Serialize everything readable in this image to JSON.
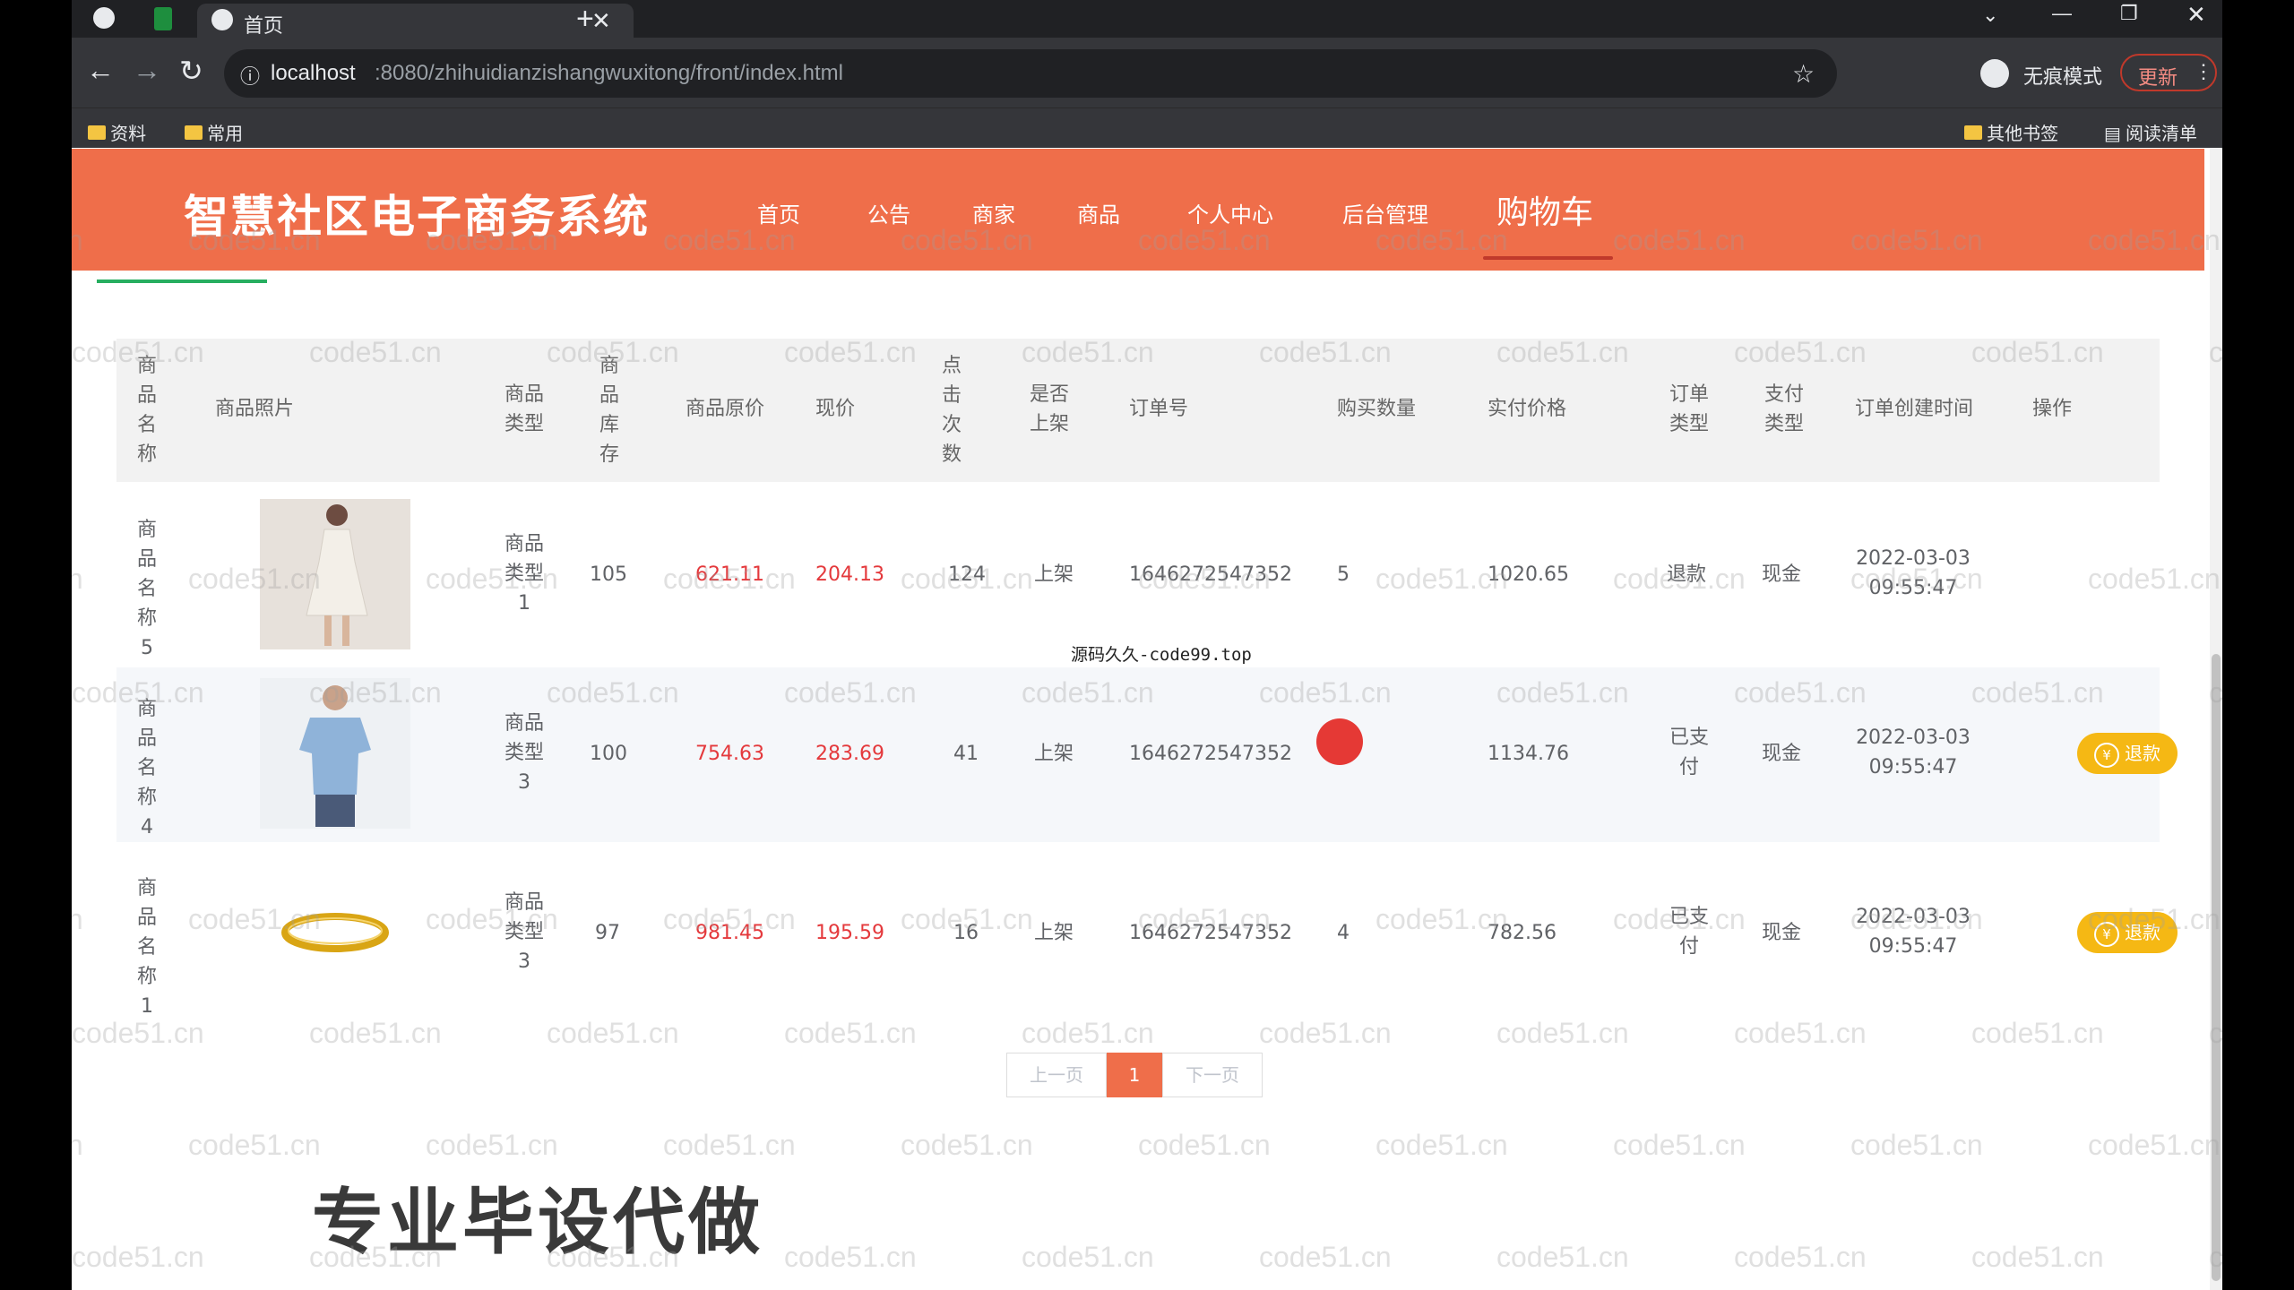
{
  "browser": {
    "tab_title": "首页",
    "url_host": "localhost",
    "url_path": ":8080/zhihuidianzishangwuxitong/front/index.html",
    "incognito_label": "无痕模式",
    "update_label": "更新",
    "bookmarks": [
      "资料",
      "常用"
    ],
    "other_bookmarks": "其他书签",
    "reading_list": "阅读清单"
  },
  "site": {
    "title": "智慧社区电子商务系统",
    "nav": [
      "首页",
      "公告",
      "商家",
      "商品",
      "个人中心",
      "后台管理",
      "购物车"
    ]
  },
  "table": {
    "headers": {
      "name": "商品名称",
      "photo": "商品照片",
      "type": "商品类型",
      "stock": "商品库存",
      "orig_price": "商品原价",
      "price": "现价",
      "clicks": "点击次数",
      "listed": "是否上架",
      "order_no": "订单号",
      "qty": "购买数量",
      "paid": "实付价格",
      "order_type": "订单类型",
      "pay_type": "支付类型",
      "created": "订单创建时间",
      "op": "操作"
    },
    "rows": [
      {
        "name": "商品名称5",
        "type": "商品类型1",
        "stock": "105",
        "orig_price": "621.11",
        "price": "204.13",
        "clicks": "124",
        "listed": "上架",
        "order_no": "1646272547352",
        "qty": "5",
        "paid": "1020.65",
        "order_type": "退款",
        "pay_type": "现金",
        "created": "2022-03-03 09:55:47",
        "action": ""
      },
      {
        "name": "商品名称4",
        "type": "商品类型3",
        "stock": "100",
        "orig_price": "754.63",
        "price": "283.69",
        "clicks": "41",
        "listed": "上架",
        "order_no": "1646272547352",
        "qty": "",
        "paid": "1134.76",
        "order_type": "已支付",
        "pay_type": "现金",
        "created": "2022-03-03 09:55:47",
        "action": "退款"
      },
      {
        "name": "商品名称1",
        "type": "商品类型3",
        "stock": "97",
        "orig_price": "981.45",
        "price": "195.59",
        "clicks": "16",
        "listed": "上架",
        "order_no": "1646272547352",
        "qty": "4",
        "paid": "782.56",
        "order_type": "已支付",
        "pay_type": "现金",
        "created": "2022-03-03 09:55:47",
        "action": "退款"
      }
    ]
  },
  "pagination": {
    "prev": "上一页",
    "current": "1",
    "next": "下一页"
  },
  "overlays": {
    "watermark": "code51.cn",
    "source": "源码久久-code99.top",
    "ad": "专业毕设代做"
  },
  "colors": {
    "header": "#ef6e4a",
    "price_red": "#e4393c",
    "refund_button": "#f5b814"
  }
}
